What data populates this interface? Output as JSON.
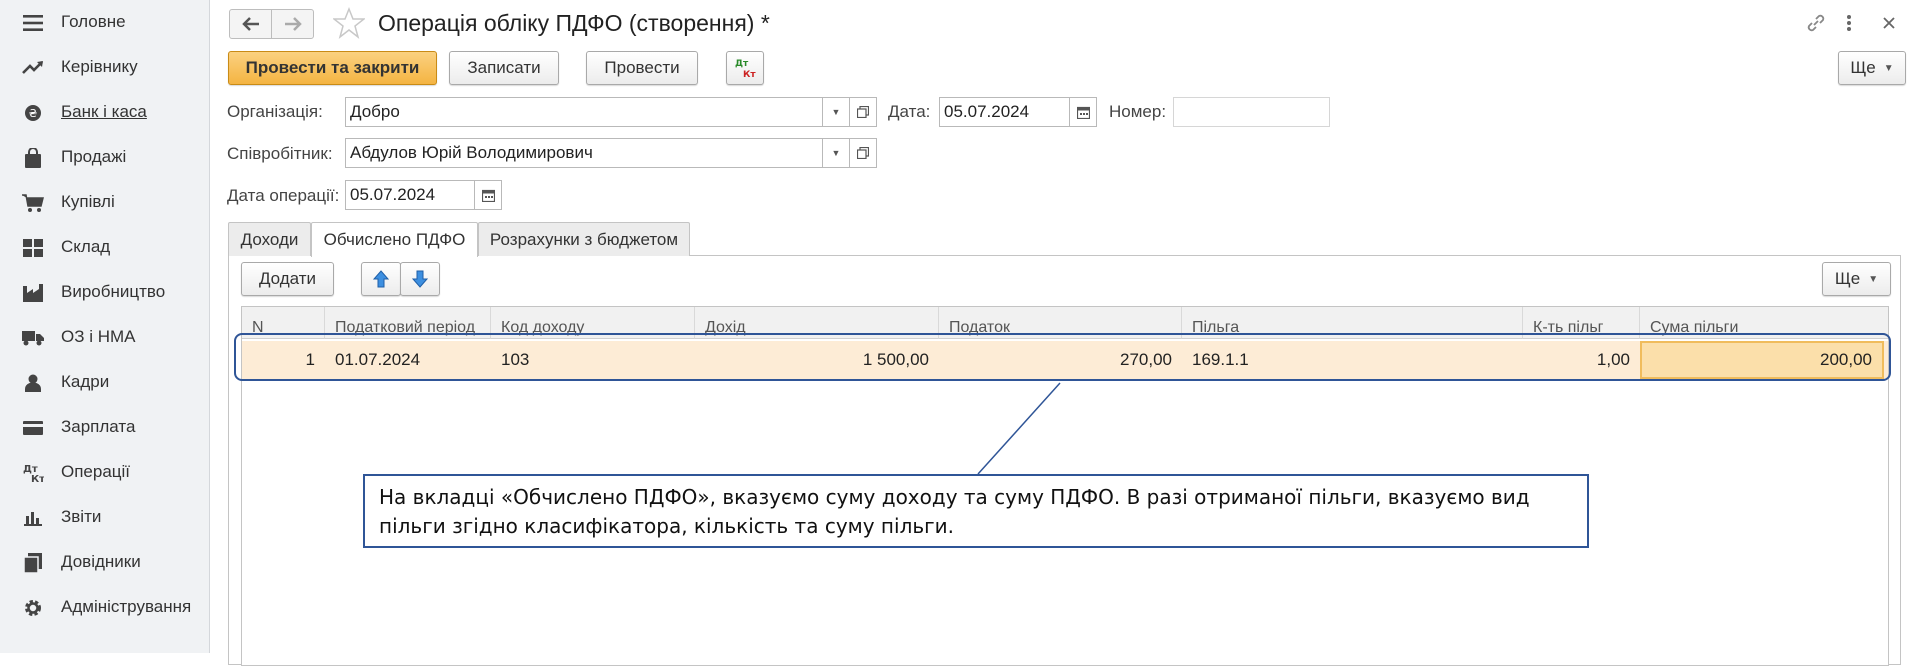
{
  "sidebar": {
    "items": [
      {
        "label": "Головне",
        "icon": "menu-icon"
      },
      {
        "label": "Керівнику",
        "icon": "trend-icon"
      },
      {
        "label": "Банк і каса",
        "icon": "coin-icon"
      },
      {
        "label": "Продажі",
        "icon": "bag-icon"
      },
      {
        "label": "Купівлі",
        "icon": "cart-icon"
      },
      {
        "label": "Склад",
        "icon": "grid-icon"
      },
      {
        "label": "Виробництво",
        "icon": "factory-icon"
      },
      {
        "label": "ОЗ і НМА",
        "icon": "truck-icon"
      },
      {
        "label": "Кадри",
        "icon": "person-icon"
      },
      {
        "label": "Зарплата",
        "icon": "card-icon"
      },
      {
        "label": "Операції",
        "icon": "dt-kt-icon"
      },
      {
        "label": "Звіти",
        "icon": "bar-chart-icon"
      },
      {
        "label": "Довідники",
        "icon": "book-icon"
      },
      {
        "label": "Адміністрування",
        "icon": "gear-icon"
      }
    ]
  },
  "header": {
    "title": "Операція обліку ПДФО (створення) *"
  },
  "toolbar": {
    "post_and_close": "Провести та закрити",
    "save": "Записати",
    "post": "Провести",
    "more": "Ще"
  },
  "form": {
    "org_label": "Організація:",
    "org_value": "Добро",
    "date_label": "Дата:",
    "date_value": "05.07.2024",
    "number_label": "Номер:",
    "number_value": "",
    "employee_label": "Співробітник:",
    "employee_value": "Абдулов Юрій Володимирович",
    "op_date_label": "Дата операції:",
    "op_date_value": "05.07.2024"
  },
  "tabs": [
    {
      "label": "Доходи"
    },
    {
      "label": "Обчислено ПДФО"
    },
    {
      "label": "Розрахунки з бюджетом"
    }
  ],
  "table_toolbar": {
    "add": "Додати",
    "more": "Ще"
  },
  "table": {
    "columns": [
      "N",
      "Податковий період",
      "Код доходу",
      "Дохід",
      "Податок",
      "Пільга",
      "К-ть пільг",
      "Сума пільги"
    ],
    "rows": [
      {
        "n": "1",
        "period": "01.07.2024",
        "code": "103",
        "income": "1 500,00",
        "tax": "270,00",
        "benefit": "169.1.1",
        "count": "1,00",
        "amount": "200,00"
      }
    ]
  },
  "callout": {
    "text": "На вкладці «Обчислено ПДФО», вказуємо суму доходу та суму ПДФО. В разі отриманої пільги, вказуємо вид пільги згідно класифікатора, кількість та суму пільги."
  },
  "colors": {
    "primary_button": "#f4b442",
    "row_highlight": "#fdecd6",
    "annotation": "#2f5597"
  }
}
